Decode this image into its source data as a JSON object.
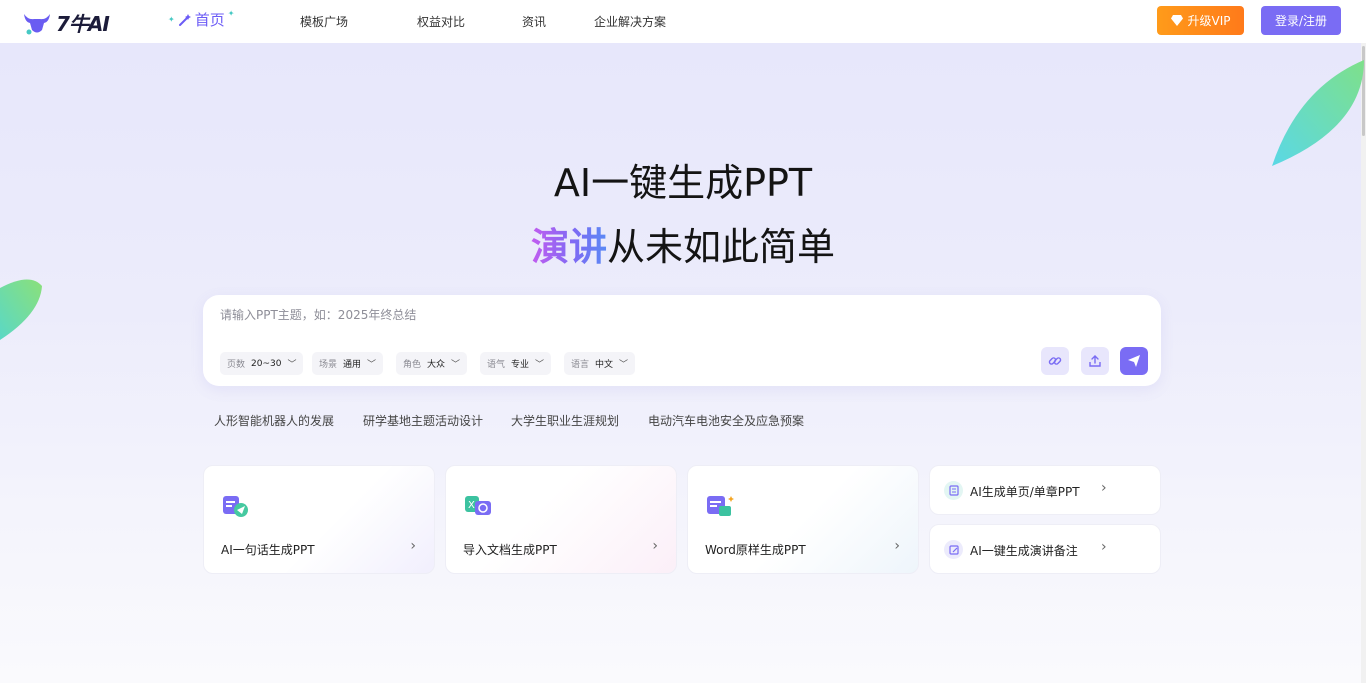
{
  "brand": {
    "name": "7牛AI"
  },
  "nav": {
    "home": "首页",
    "items": [
      "模板广场",
      "权益对比",
      "资讯",
      "企业解决方案"
    ]
  },
  "header": {
    "vip_label": "升级VIP",
    "login_label": "登录/注册"
  },
  "hero": {
    "title": "AI一键生成PPT",
    "sub_highlight": "演讲",
    "sub_rest": "从未如此简单"
  },
  "input": {
    "placeholder": "请输入PPT主题，如：2025年终总结",
    "value": "",
    "options": [
      {
        "label": "页数",
        "value": "20~30"
      },
      {
        "label": "场景",
        "value": "通用"
      },
      {
        "label": "角色",
        "value": "大众"
      },
      {
        "label": "语气",
        "value": "专业"
      },
      {
        "label": "语言",
        "value": "中文"
      }
    ],
    "actions": [
      "link-icon",
      "upload-icon",
      "send-icon"
    ]
  },
  "suggestions": [
    "人形智能机器人的发展",
    "研学基地主题活动设计",
    "大学生职业生涯规划",
    "电动汽车电池安全及应急预案"
  ],
  "cards": [
    {
      "label": "AI一句话生成PPT",
      "icon": "chat-send-icon"
    },
    {
      "label": "导入文档生成PPT",
      "icon": "excel-import-icon"
    },
    {
      "label": "Word原样生成PPT",
      "icon": "word-convert-icon"
    }
  ],
  "mini_cards": [
    {
      "label": "AI生成单页/单章PPT",
      "icon": "page-icon"
    },
    {
      "label": "AI一键生成演讲备注",
      "icon": "edit-note-icon"
    }
  ],
  "colors": {
    "accent": "#7a6cf4",
    "vip": "#ff8c1a",
    "background": "#ececfb"
  }
}
